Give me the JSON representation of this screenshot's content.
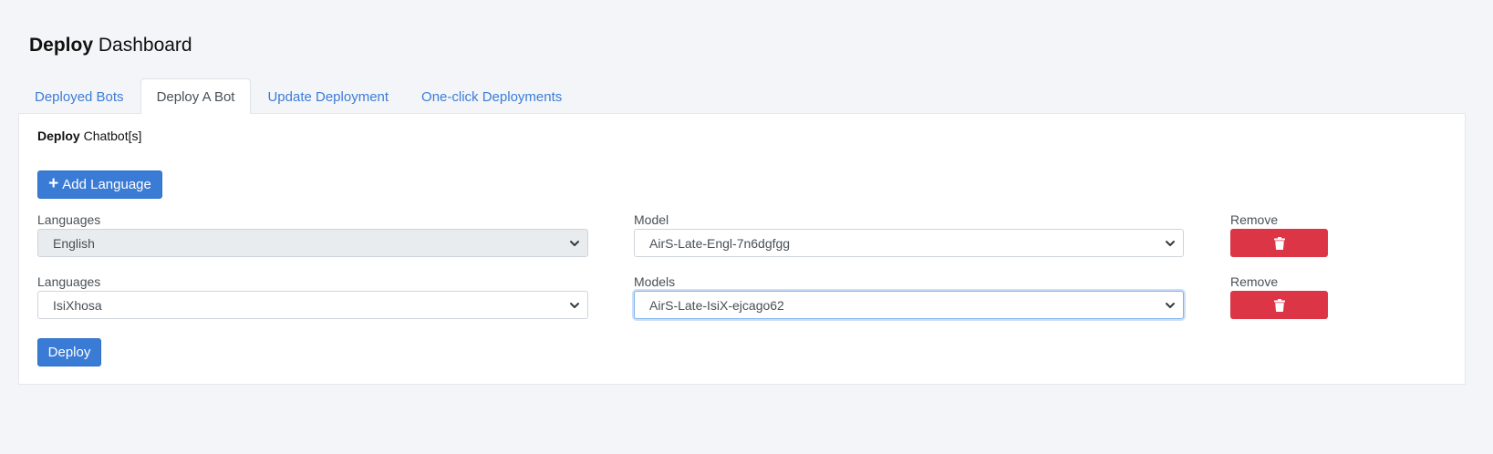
{
  "header": {
    "title_bold": "Deploy",
    "title_rest": "Dashboard"
  },
  "tabs": [
    {
      "label": "Deployed Bots",
      "active": false
    },
    {
      "label": "Deploy A Bot",
      "active": true
    },
    {
      "label": "Update Deployment",
      "active": false
    },
    {
      "label": "One-click Deployments",
      "active": false
    }
  ],
  "card": {
    "title_bold": "Deploy",
    "title_rest": "Chatbot[s]",
    "add_language_label": "Add Language",
    "deploy_label": "Deploy",
    "rows": [
      {
        "language_label": "Languages",
        "language_value": "English",
        "language_disabled": true,
        "model_label": "Model",
        "model_value": "AirS-Late-Engl-7n6dgfgg",
        "remove_label": "Remove"
      },
      {
        "language_label": "Languages",
        "language_value": "IsiXhosa",
        "language_disabled": false,
        "model_label": "Models",
        "model_value": "AirS-Late-IsiX-ejcago62",
        "remove_label": "Remove"
      }
    ]
  },
  "icons": {
    "add": "plus-icon",
    "remove": "trash-icon",
    "dropdown": "chevron-down-icon"
  },
  "colors": {
    "primary": "#3a7bd5",
    "danger": "#dc3545",
    "tab_link": "#3b7dd8",
    "background": "#f4f5f8"
  }
}
